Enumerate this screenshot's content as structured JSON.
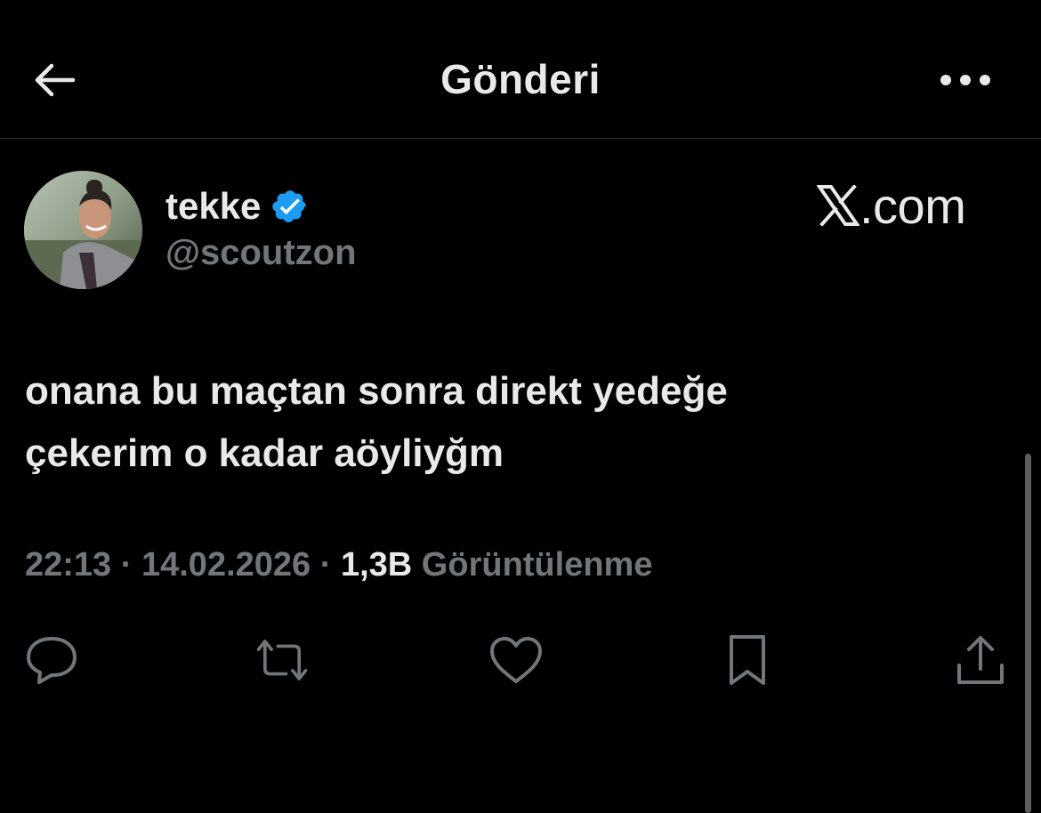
{
  "header": {
    "title": "Gönderi",
    "back_icon": "arrow-left-icon",
    "more_icon": "more-horizontal-icon"
  },
  "author": {
    "display_name": "tekke",
    "handle": "@scoutzon",
    "verified": true,
    "verified_color": "#1d9bf0"
  },
  "watermark": {
    "logo": "X",
    "text": ".com"
  },
  "tweet": {
    "line1": "onana bu maçtan sonra direkt yedeğe",
    "line2": "çekerim o kadar aöyliyğm"
  },
  "meta": {
    "time": "22:13",
    "separator": "·",
    "date": "14.02.2026",
    "views_count": "1,3B",
    "views_label": "Görüntülenme"
  },
  "actions": [
    {
      "icon": "reply-icon"
    },
    {
      "icon": "retweet-icon"
    },
    {
      "icon": "like-icon"
    },
    {
      "icon": "bookmark-icon"
    },
    {
      "icon": "share-icon"
    }
  ],
  "colors": {
    "background": "#000000",
    "text_primary": "#e7e9ea",
    "text_secondary": "#71767b",
    "divider": "#2f3336"
  }
}
